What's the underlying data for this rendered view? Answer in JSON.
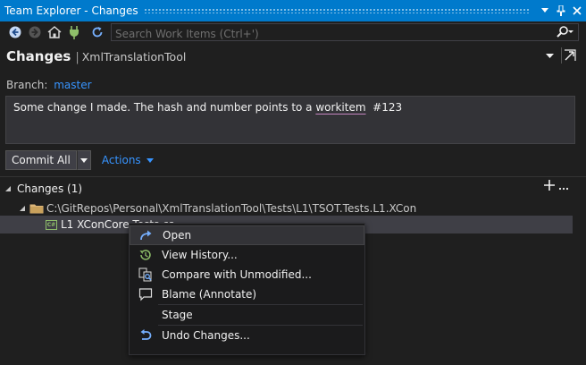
{
  "window": {
    "title": "Team Explorer - Changes"
  },
  "toolbar": {
    "search_placeholder": "Search Work Items (Ctrl+')"
  },
  "header": {
    "title": "Changes",
    "separator": "|",
    "repo": "XmlTranslationTool"
  },
  "branch": {
    "label": "Branch:",
    "value": "master"
  },
  "commit": {
    "message_before": "Some change I made. The hash and number points to a ",
    "message_link": "workitem",
    "message_after": "  #123",
    "button_label": "Commit All",
    "actions_label": "Actions"
  },
  "changes": {
    "header": "Changes (1)",
    "folder_path": "C:\\GitRepos\\Personal\\XmlTranslationTool\\Tests\\L1\\TSOT.Tests.L1.XCon",
    "file_badge": "C#",
    "file_name": "L1 XConCore Tests.cs"
  },
  "context_menu": {
    "items": [
      {
        "label": "Open",
        "icon": "open-arrow-icon"
      },
      {
        "label": "View History...",
        "icon": "history-icon"
      },
      {
        "label": "Compare with Unmodified...",
        "icon": "compare-icon"
      },
      {
        "label": "Blame (Annotate)",
        "icon": "comment-icon"
      },
      {
        "label": "Stage",
        "icon": ""
      },
      {
        "label": "Undo Changes...",
        "icon": "undo-icon"
      }
    ]
  },
  "colors": {
    "accent": "#007acc",
    "link": "#3794ff",
    "background": "#1f1f1f",
    "menu_bg": "#1b1b1c",
    "selection": "#3f3f46"
  }
}
